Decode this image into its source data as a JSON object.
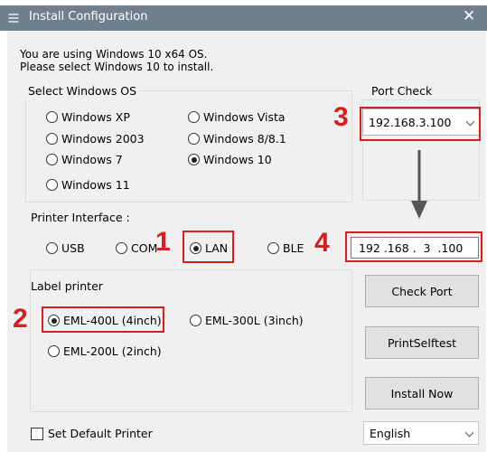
{
  "window": {
    "title": "Install Configuration",
    "close_label": "✕"
  },
  "os_note": {
    "line1": "You are using Windows 10 x64 OS.",
    "line2": "Please select Windows 10 to install."
  },
  "os_group": {
    "legend": "Select Windows OS",
    "options": [
      {
        "label": "Windows XP",
        "selected": false
      },
      {
        "label": "Windows Vista",
        "selected": false
      },
      {
        "label": "Windows 2003",
        "selected": false
      },
      {
        "label": "Windows 8/8.1",
        "selected": false
      },
      {
        "label": "Windows 7",
        "selected": false
      },
      {
        "label": "Windows 10",
        "selected": true
      },
      {
        "label": "Windows 11",
        "selected": false
      }
    ]
  },
  "port_check": {
    "legend": "Port Check",
    "ip_combo_value": "192.168.3.100"
  },
  "printer_interface": {
    "label": "Printer Interface :",
    "options": [
      {
        "label": "USB",
        "selected": false
      },
      {
        "label": "COM",
        "selected": false
      },
      {
        "label": "LAN",
        "selected": true
      },
      {
        "label": "BLE",
        "selected": false
      }
    ],
    "ip_input_value": "192 .168 .  3  .100"
  },
  "label_printer": {
    "legend": "Label printer",
    "options": [
      {
        "label": "EML-400L (4inch)",
        "selected": true
      },
      {
        "label": "EML-300L (3inch)",
        "selected": false
      },
      {
        "label": "EML-200L (2inch)",
        "selected": false
      }
    ]
  },
  "buttons": {
    "check_port": "Check Port",
    "print_selftest": "PrintSelftest",
    "install_now": "Install Now"
  },
  "default_printer": {
    "label": "Set Default Printer",
    "checked": false
  },
  "language": {
    "value": "English"
  },
  "annotations": {
    "n1": "1",
    "n2": "2",
    "n3": "3",
    "n4": "4"
  },
  "colors": {
    "titlebar": "#6f7f8c",
    "window_bg": "#f0f0f0",
    "annotation_red": "#d42020"
  }
}
